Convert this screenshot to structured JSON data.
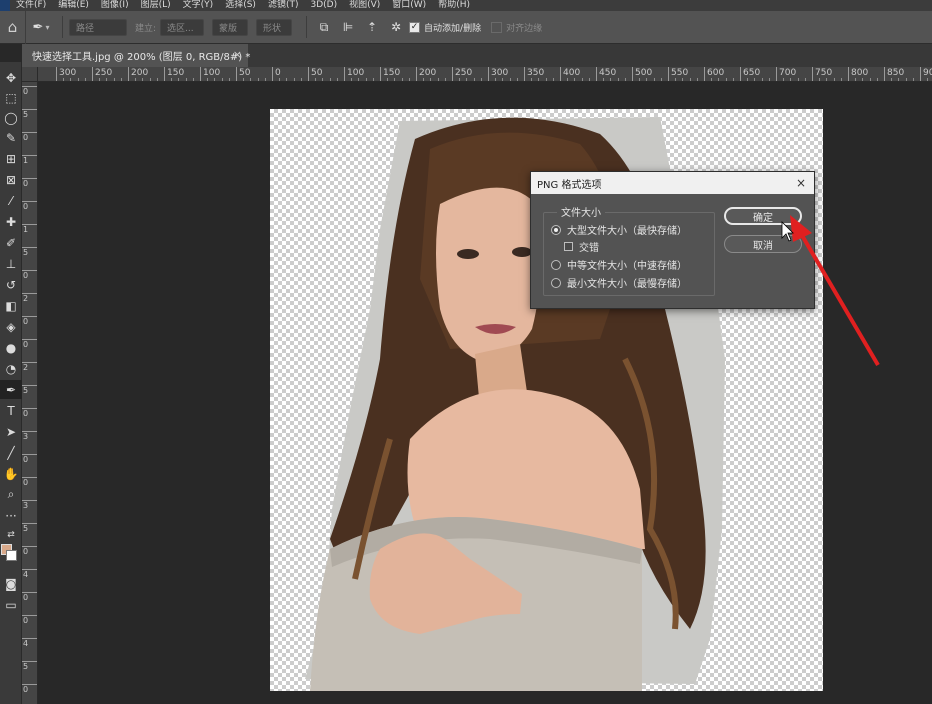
{
  "menubar": {
    "items": [
      "文件(F)",
      "编辑(E)",
      "图像(I)",
      "图层(L)",
      "文字(Y)",
      "选择(S)",
      "滤镜(T)",
      "3D(D)",
      "视图(V)",
      "窗口(W)",
      "帮助(H)"
    ]
  },
  "options_bar": {
    "mode_value": "路径",
    "make_label": "建立:",
    "selection_btn": "选区...",
    "mask_btn": "蒙版",
    "shape_btn": "形状",
    "auto_add_delete": "自动添加/删除",
    "auto_add_delete_checked": true,
    "align_edges": "对齐边缘",
    "align_edges_checked": false
  },
  "document_tab": {
    "title": "快速选择工具.jpg @ 200% (图层 0, RGB/8#) *",
    "close": "×"
  },
  "ruler": {
    "top_ticks": [
      "300",
      "250",
      "200",
      "150",
      "100",
      "50",
      "0",
      "50",
      "100",
      "150",
      "200",
      "250",
      "300",
      "350",
      "400",
      "450",
      "500",
      "550",
      "600",
      "650",
      "700",
      "750",
      "800",
      "850",
      "900"
    ],
    "left_ticks": [
      "0",
      "5",
      "0",
      "1",
      "0",
      "0",
      "1",
      "5",
      "0",
      "2",
      "0",
      "0",
      "2",
      "5",
      "0",
      "3",
      "0",
      "0",
      "3",
      "5",
      "0",
      "4",
      "0",
      "0",
      "4",
      "5",
      "0"
    ]
  },
  "toolbox": {
    "tools": [
      "move-icon",
      "marquee-icon",
      "lasso-icon",
      "quick-select-icon",
      "crop-icon",
      "frame-icon",
      "eyedropper-icon",
      "healing-icon",
      "brush-icon",
      "stamp-icon",
      "history-brush-icon",
      "eraser-icon",
      "paint-bucket-icon",
      "blur-icon",
      "dodge-icon",
      "pen-icon",
      "type-icon",
      "path-select-icon",
      "line-icon",
      "hand-icon",
      "zoom-icon",
      "more-icon"
    ],
    "foreground_color": "#d9a98a",
    "background_color": "#ffffff"
  },
  "dialog": {
    "title": "PNG 格式选项",
    "close": "×",
    "group_label": "文件大小",
    "options": [
      {
        "label": "大型文件大小（最快存储）",
        "selected": true
      },
      {
        "label": "中等文件大小（中速存储）",
        "selected": false
      },
      {
        "label": "最小文件大小（最慢存储）",
        "selected": false
      }
    ],
    "interlace_label": "交错",
    "interlace_checked": false,
    "ok_label": "确定",
    "cancel_label": "取消"
  },
  "colors": {
    "annotation_arrow": "#e02020",
    "canvas_checker": "#cccccc",
    "workspace": "#282828"
  }
}
